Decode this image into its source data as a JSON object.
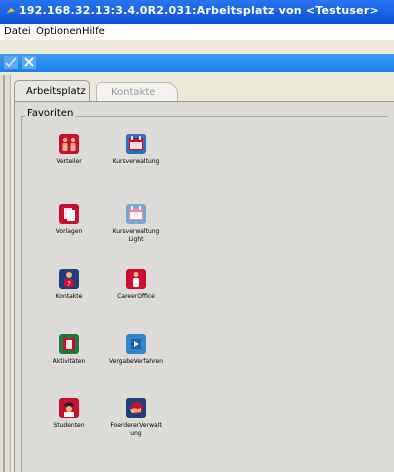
{
  "window": {
    "title": "192.168.32.13:3.4.0R2.031:Arbeitsplatz von <Testuser>"
  },
  "menu": {
    "items": [
      "Datei",
      "Optionen",
      "Hilfe"
    ]
  },
  "toolbar": {
    "buttons": [
      {
        "name": "check-icon",
        "label": ""
      },
      {
        "name": "close-icon",
        "label": ""
      }
    ]
  },
  "tabs": [
    {
      "label": "Arbeitsplatz",
      "active": true
    },
    {
      "label": "Kontakte",
      "active": false
    }
  ],
  "favorites": {
    "legend": "Favoriten",
    "items": [
      {
        "label": "Verteiler",
        "icon": "people-group-icon",
        "color": "#c8102e"
      },
      {
        "label": "Kursverwaltung",
        "icon": "calendar-icon",
        "color": "#2e6fb6"
      },
      {
        "label": "Vorlagen",
        "icon": "documents-icon",
        "color": "#c8102e"
      },
      {
        "label": "Kursverwaltung Light",
        "icon": "calendar-light-icon",
        "color": "#7aa6d8"
      },
      {
        "label": "Kontakte",
        "icon": "contact-question-icon",
        "color": "#1d3f7a"
      },
      {
        "label": "CareerOffice",
        "icon": "career-person-icon",
        "color": "#c8102e"
      },
      {
        "label": "Aktivitäten",
        "icon": "activities-icon",
        "color": "#1f7a3a"
      },
      {
        "label": "VergabeVerfahren",
        "icon": "procedure-icon",
        "color": "#2e86c8"
      },
      {
        "label": "Studenten",
        "icon": "graduate-icon",
        "color": "#c8102e"
      },
      {
        "label": "FoerdererVerwaltung",
        "icon": "sponsor-hand-icon",
        "color": "#1d3f7a"
      }
    ]
  }
}
